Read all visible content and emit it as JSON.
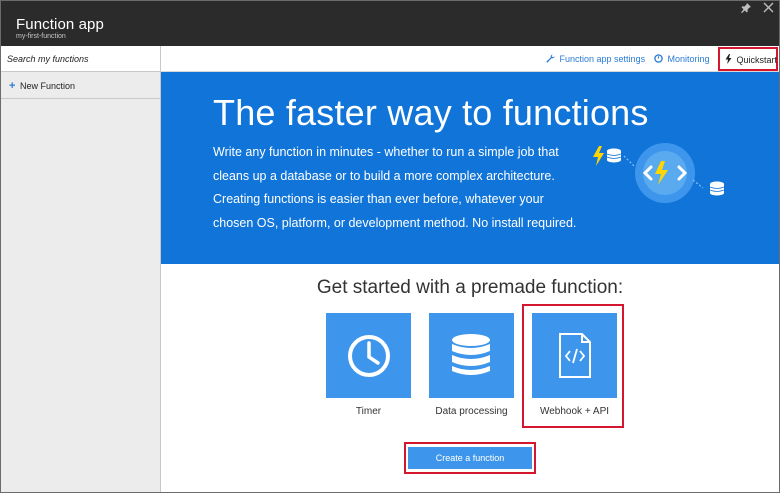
{
  "header": {
    "title": "Function app",
    "subtitle": "my-first-function"
  },
  "window_controls": [
    {
      "icon": "pin-icon"
    },
    {
      "icon": "close-icon"
    }
  ],
  "sidebar": {
    "search_placeholder": "Search my functions",
    "new_function_label": "New Function"
  },
  "topnav": {
    "settings_label": "Function app settings",
    "monitoring_label": "Monitoring",
    "quickstart_label": "Quickstart"
  },
  "hero": {
    "title": "The faster way to functions",
    "description": "Write any function in minutes - whether to run a simple job that cleans up a database or to build a more complex architecture. Creating functions is easier than ever before, whatever your chosen OS, platform, or development method. No install required."
  },
  "premade": {
    "heading": "Get started with a premade function:",
    "tiles": [
      {
        "label": "Timer",
        "icon": "clock-icon",
        "selected": false
      },
      {
        "label": "Data processing",
        "icon": "database-icon",
        "selected": false
      },
      {
        "label": "Webhook + API",
        "icon": "code-file-icon",
        "selected": true
      }
    ],
    "create_label": "Create a function"
  },
  "colors": {
    "titlebar": "#2b2b2b",
    "hero_blue": "#1074d9",
    "tile_blue": "#3e96ec",
    "link_blue": "#2a7bd6",
    "highlight_red": "#d5162f",
    "sidebar_bg": "#ececec"
  }
}
